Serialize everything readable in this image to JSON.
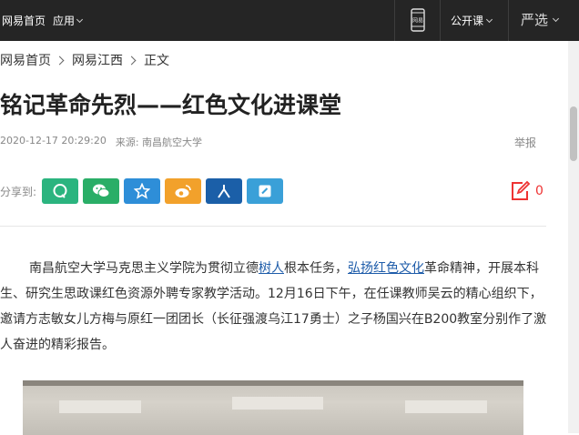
{
  "topbar": {
    "home": "网易首页",
    "apps": "应用",
    "phone_label": "网易",
    "course": "公开课",
    "yanxuan": "严选"
  },
  "breadcrumb": [
    "网易首页",
    "网易江西",
    "正文"
  ],
  "article": {
    "title": "铭记革命先烈——红色文化进课堂",
    "date": "2020-12-17 20:29:20",
    "source": "来源: 南昌航空大学",
    "report": "举报",
    "share_label": "分享到:",
    "comment_count": "0",
    "para_parts": {
      "p1": "南昌航空大学马克思主义学院为贯彻立德",
      "link1": "树人",
      "p2": "根本任务，",
      "link2": "弘扬红色文化",
      "p3": "革命精神，开展本科生、研究生思政课红色资源外聘专家教学活动。12月16日下午，在任课教师吴云的精心组织下，邀请方志敏女儿方梅与原红一团团长（长征强渡乌江17勇士）之子杨国兴在B200教室分别作了激人奋进的精彩报告。"
    }
  },
  "share_buttons": [
    {
      "name": "qq-icon",
      "color": "#2bb47f"
    },
    {
      "name": "wechat-icon",
      "color": "#2aae67"
    },
    {
      "name": "qzone-star-icon",
      "color": "#2e8ed8"
    },
    {
      "name": "weibo-icon",
      "color": "#f2a12b"
    },
    {
      "name": "renren-icon",
      "color": "#1b5fa8"
    },
    {
      "name": "yixin-icon",
      "color": "#3aa0d8"
    }
  ]
}
